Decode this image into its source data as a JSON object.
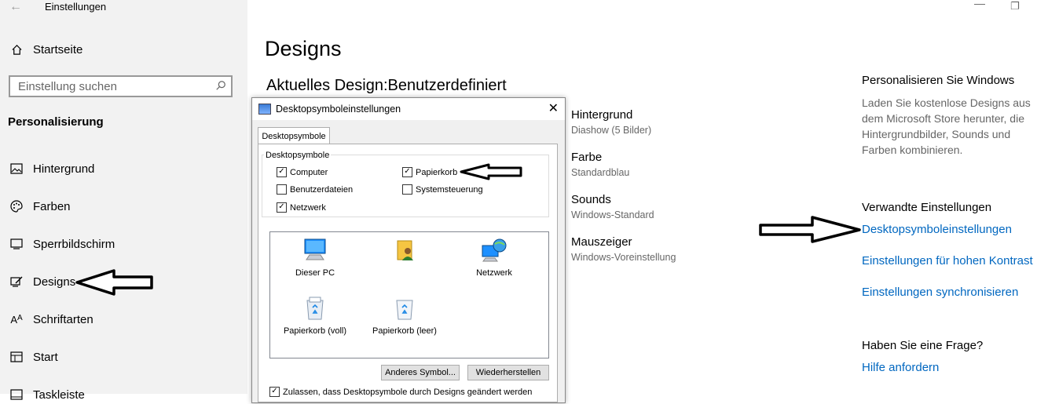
{
  "window": {
    "back_icon": "arrow-left-icon",
    "title": "Einstellungen",
    "minimize": "—",
    "restore": "❐"
  },
  "sidebar": {
    "home_label": "Startseite",
    "search_placeholder": "Einstellung suchen",
    "section_title": "Personalisierung",
    "items": [
      {
        "label": "Hintergrund",
        "icon": "picture-icon"
      },
      {
        "label": "Farben",
        "icon": "palette-icon"
      },
      {
        "label": "Sperrbildschirm",
        "icon": "lock-screen-icon"
      },
      {
        "label": "Designs",
        "icon": "designs-icon"
      },
      {
        "label": "Schriftarten",
        "icon": "fonts-icon"
      },
      {
        "label": "Start",
        "icon": "start-icon"
      },
      {
        "label": "Taskleiste",
        "icon": "taskbar-icon"
      }
    ]
  },
  "main": {
    "title": "Designs",
    "current_design": "Aktuelles Design:Benutzerdefiniert",
    "settings": [
      {
        "title": "Hintergrund",
        "sub": "Diashow (5 Bilder)"
      },
      {
        "title": "Farbe",
        "sub": "Standardblau"
      },
      {
        "title": "Sounds",
        "sub": "Windows-Standard"
      },
      {
        "title": "Mauszeiger",
        "sub": "Windows-Voreinstellung"
      }
    ]
  },
  "right": {
    "heading1": "Personalisieren Sie Windows",
    "text1": "Laden Sie kostenlose Designs aus dem Microsoft Store herunter, die Hintergrundbilder, Sounds und Farben kombinieren.",
    "heading2": "Verwandte Einstellungen",
    "links": [
      "Desktopsymboleinstellungen",
      "Einstellungen für hohen Kontrast",
      "Einstellungen synchronisieren"
    ],
    "heading3": "Haben Sie eine Frage?",
    "help_link": "Hilfe anfordern",
    "link_color": "#0067c0"
  },
  "dialog": {
    "title": "Desktopsymboleinstellungen",
    "close": "✕",
    "tab": "Desktopsymbole",
    "group_label": "Desktopsymbole",
    "checkboxes": [
      {
        "label": "Computer",
        "checked": true
      },
      {
        "label": "Papierkorb",
        "checked": true
      },
      {
        "label": "Benutzerdateien",
        "checked": false
      },
      {
        "label": "Systemsteuerung",
        "checked": false
      },
      {
        "label": "Netzwerk",
        "checked": true
      }
    ],
    "icons": [
      {
        "label": "Dieser PC",
        "icon": "computer-icon"
      },
      {
        "label": "",
        "icon": "user-folder-icon"
      },
      {
        "label": "Netzwerk",
        "icon": "network-icon"
      },
      {
        "label": "Papierkorb (voll)",
        "icon": "recycle-bin-full-icon"
      },
      {
        "label": "Papierkorb (leer)",
        "icon": "recycle-bin-empty-icon"
      }
    ],
    "btn_change": "Anderes Symbol...",
    "btn_restore": "Wiederherstellen",
    "allow_label": "Zulassen, dass Desktopsymbole durch Designs geändert werden",
    "allow_checked": true
  }
}
